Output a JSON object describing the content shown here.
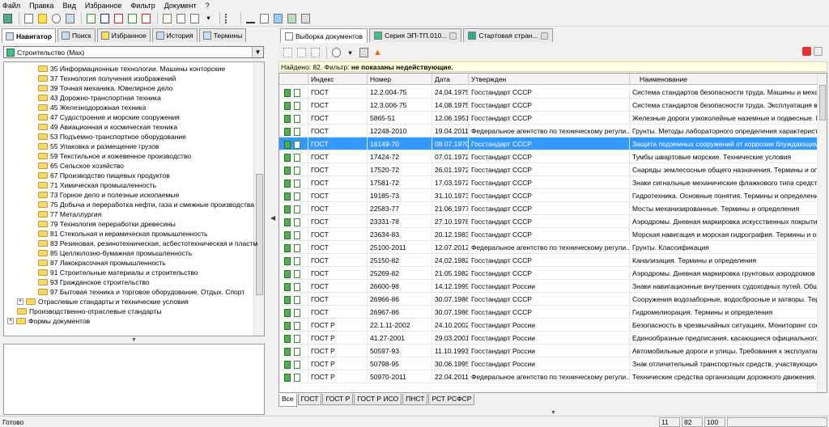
{
  "menu": [
    "Файл",
    "Правка",
    "Вид",
    "Избранное",
    "Фильтр",
    "Документ",
    "?"
  ],
  "left_tabs": [
    "Навигатор",
    "Поиск",
    "Избранное",
    "История",
    "Термины"
  ],
  "combo": {
    "value": "Строительство (Max)"
  },
  "tree": [
    {
      "label": "35 Информационные технологии. Машины конторские",
      "level": 2
    },
    {
      "label": "37 Технология получения изображений",
      "level": 2
    },
    {
      "label": "39 Точная механика. Ювелирное дело",
      "level": 2
    },
    {
      "label": "43 Дорожно-транспортная техника",
      "level": 2
    },
    {
      "label": "45 Железнодорожная техника",
      "level": 2
    },
    {
      "label": "47 Судостроение и морские сооружения",
      "level": 2
    },
    {
      "label": "49 Авиационная и космическая техника",
      "level": 2
    },
    {
      "label": "53 Подъемно-транспортное оборудование",
      "level": 2
    },
    {
      "label": "55 Упаковка и размещение грузов",
      "level": 2
    },
    {
      "label": "59 Текстильное и кожевенное производство",
      "level": 2
    },
    {
      "label": "65 Сельское хозяйство",
      "level": 2
    },
    {
      "label": "67 Производство пищевых продуктов",
      "level": 2
    },
    {
      "label": "71 Химическая промышленность",
      "level": 2
    },
    {
      "label": "73 Горное дело и полезные ископаемые",
      "level": 2
    },
    {
      "label": "75 Добыча и переработка нефти, газа и смежные производства",
      "level": 2
    },
    {
      "label": "77 Металлургия",
      "level": 2
    },
    {
      "label": "79 Технология переработки древесины",
      "level": 2
    },
    {
      "label": "81 Стекольная и керамическая промышленность",
      "level": 2
    },
    {
      "label": "83 Резиновая, резинотехническая, асбестотехническая и пластм",
      "level": 2
    },
    {
      "label": "85 Целлюлозно-бумажная промышленность",
      "level": 2
    },
    {
      "label": "87 Лакокрасочная промышленность",
      "level": 2
    },
    {
      "label": "91 Строительные материалы и строительство",
      "level": 2
    },
    {
      "label": "93 Гражданское строительство",
      "level": 2
    },
    {
      "label": "97 Бытовая техника и торговое оборудование. Отдых. Спорт",
      "level": 2
    },
    {
      "label": "Отраслевые стандарты и технические условия",
      "level": 1,
      "expander": "+"
    },
    {
      "label": "Производственно-отраслевые стандарты",
      "level": 1
    },
    {
      "label": "Формы документов",
      "level": 0,
      "expander": "+"
    }
  ],
  "right_tabs": [
    "Выборка документов",
    "Серия ЭП-ТП.010...",
    "Стартовая стран..."
  ],
  "found": {
    "prefix": "Найдено: 82. Фильтр: ",
    "mid": "не показаны ",
    "bold": "недействующие."
  },
  "columns": [
    "Индекс",
    "Номер",
    "Дата",
    "Утвержден",
    "Наименование"
  ],
  "rows": [
    [
      "ГОСТ",
      "12.2.004-75",
      "24.04.1975",
      "Госстандарт СССР",
      "Система стандартов безопасности труда. Машины и механ"
    ],
    [
      "ГОСТ",
      "12.3.006-75",
      "14.08.1975",
      "Госстандарт СССР",
      "Система стандартов безопасности труда. Эксплуатация вод"
    ],
    [
      "ГОСТ",
      "5865-51",
      "12.06.1951",
      "Госстандарт СССР",
      "Железные дороги узкоколейные наземные и подвесные. Ш"
    ],
    [
      "ГОСТ",
      "12248-2010",
      "19.04.2011",
      "Федеральное агентство по техническому регули...",
      "Грунты. Методы лабораторного определения характеристи"
    ],
    [
      "ГОСТ",
      "16149-70",
      "08.07.1970",
      "Госстандарт СССР",
      "Защита подземных сооружений от коррозии блуждающим т"
    ],
    [
      "ГОСТ",
      "17424-72",
      "07.01.1972",
      "Госстандарт СССР",
      "Тумбы швартовые морские. Технические условия"
    ],
    [
      "ГОСТ",
      "17520-72",
      "26.01.1972",
      "Госстандарт СССР",
      "Снаряды землесосные общего назначения. Термины и опр"
    ],
    [
      "ГОСТ",
      "17581-72",
      "17.03.1972",
      "Госстандарт СССР",
      "Знаки сигнальные механические флажкового типа средств"
    ],
    [
      "ГОСТ",
      "19185-73",
      "31.10.1973",
      "Госстандарт СССР",
      "Гидротехника. Основные понятия. Термины и определения"
    ],
    [
      "ГОСТ",
      "22583-77",
      "21.06.1977",
      "Госстандарт СССР",
      "Мосты механизированные. Термины и определения"
    ],
    [
      "ГОСТ",
      "23331-78",
      "27.10.1978",
      "Госстандарт СССР",
      "Аэродромы. Дневная маркировка искусственных покрытий"
    ],
    [
      "ГОСТ",
      "23634-83",
      "20.12.1983",
      "Госстандарт СССР",
      "Морская навигация и морская гидрография. Термины и опр"
    ],
    [
      "ГОСТ",
      "25100-2011",
      "12.07.2012",
      "Федеральное агентство по техническому регули...",
      "Грунты. Классификация"
    ],
    [
      "ГОСТ",
      "25150-82",
      "24.02.1982",
      "Госстандарт СССР",
      "Канализация. Термины и определения"
    ],
    [
      "ГОСТ",
      "25269-82",
      "21.05.1982",
      "Госстандарт СССР",
      "Аэродромы. Дневная маркировка грунтовых аэродромов"
    ],
    [
      "ГОСТ",
      "26600-98",
      "14.12.1999",
      "Госстандарт России",
      "Знаки навигационные внутренних судоходных путей. Общие"
    ],
    [
      "ГОСТ",
      "26966-86",
      "30.07.1986",
      "Госстандарт СССР",
      "Сооружения водозаборные, водосбросные и затворы. Терм"
    ],
    [
      "ГОСТ",
      "26967-86",
      "30.07.1986",
      "Госстандарт СССР",
      "Гидромелиорация. Термины и определения"
    ],
    [
      "ГОСТ Р",
      "22.1.11-2002",
      "24.10.2002",
      "Госстандарт России",
      "Безопасность в чрезвычайных ситуациях. Мониторинг сост"
    ],
    [
      "ГОСТ Р",
      "41.27-2001",
      "29.03.2001",
      "Госстандарт России",
      "Единообразные предписания, касающиеся официального у"
    ],
    [
      "ГОСТ Р",
      "50597-93",
      "11.10.1993",
      "Госстандарт России",
      "Автомобильные дороги и улицы. Требования к эксплуатаци"
    ],
    [
      "ГОСТ Р",
      "50798-95",
      "30.06.1995",
      "Госстандарт России",
      "Знак отличительный транспортных средств, участвующих в"
    ],
    [
      "ГОСТ Р",
      "50970-2011",
      "22.04.2011",
      "Федеральное агентство по техническому регули...",
      "Технические средства организации дорожного движения. С"
    ]
  ],
  "selected_row": 4,
  "bottom_tabs": [
    "Все",
    "ГОСТ",
    "ГОСТ Р",
    "ГОСТ Р ИСО",
    "ПНСТ",
    "РСТ РСФСР"
  ],
  "status": {
    "text": "Готово",
    "p1": "11",
    "p2": "82",
    "p3": "100"
  }
}
